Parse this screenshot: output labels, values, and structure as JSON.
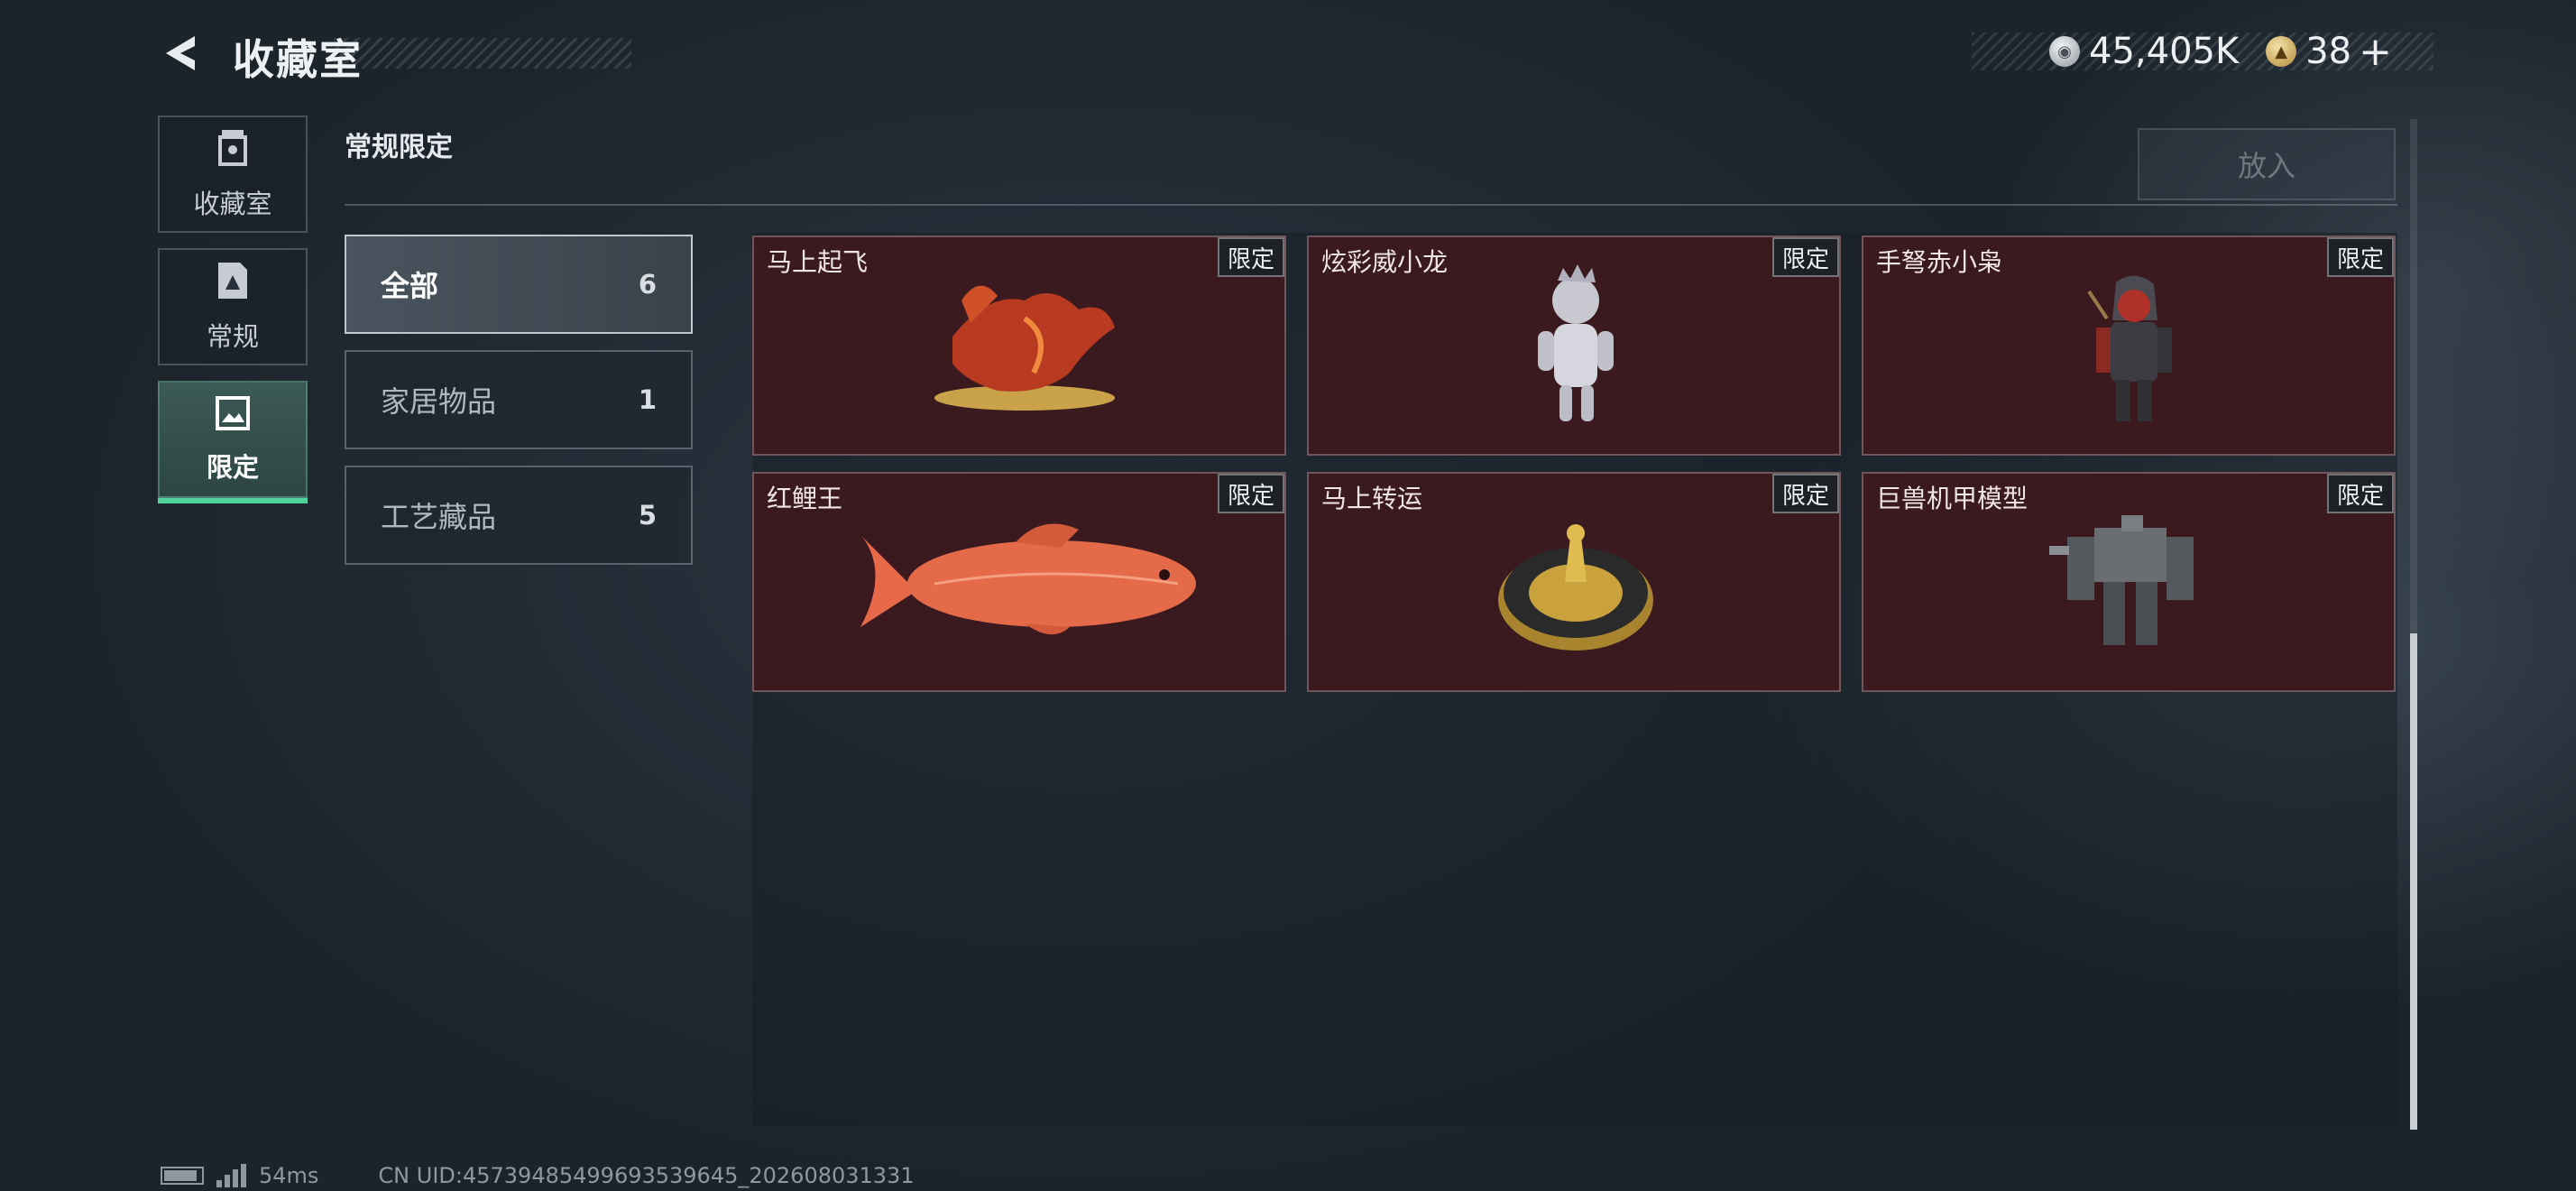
{
  "header": {
    "title": "收藏室",
    "back_icon": "back-arrow-icon",
    "currencies": [
      {
        "icon": "silver-coin-icon",
        "value": "45,405K"
      },
      {
        "icon": "gold-coin-icon",
        "value": "38"
      }
    ],
    "plus_label": "+"
  },
  "nav": {
    "items": [
      {
        "label": "收藏室",
        "icon": "trophy-icon",
        "active": false
      },
      {
        "label": "常规",
        "icon": "document-icon",
        "active": false
      },
      {
        "label": "限定",
        "icon": "image-icon",
        "active": true
      }
    ]
  },
  "section": {
    "title": "常规限定",
    "place_button": "放入"
  },
  "categories": [
    {
      "label": "全部",
      "count": "6",
      "active": true
    },
    {
      "label": "家居物品",
      "count": "1",
      "active": false
    },
    {
      "label": "工艺藏品",
      "count": "5",
      "active": false
    }
  ],
  "items": [
    {
      "name": "马上起飞",
      "badge": "限定",
      "icon": "horse-statue-icon"
    },
    {
      "name": "炫彩威小龙",
      "badge": "限定",
      "icon": "dragon-figure-icon"
    },
    {
      "name": "手弩赤小枭",
      "badge": "限定",
      "icon": "hooded-figure-icon"
    },
    {
      "name": "红鲤王",
      "badge": "限定",
      "icon": "koi-fish-icon"
    },
    {
      "name": "马上转运",
      "badge": "限定",
      "icon": "golden-wheel-icon"
    },
    {
      "name": "巨兽机甲模型",
      "badge": "限定",
      "icon": "mech-model-icon"
    }
  ],
  "footer": {
    "ping": "54ms",
    "uid": "CN UID:457394854996935396​45_202608031331"
  },
  "colors": {
    "accent": "#4fd39a",
    "card_bg": "#3a1a1f",
    "background": "#1b232b"
  }
}
